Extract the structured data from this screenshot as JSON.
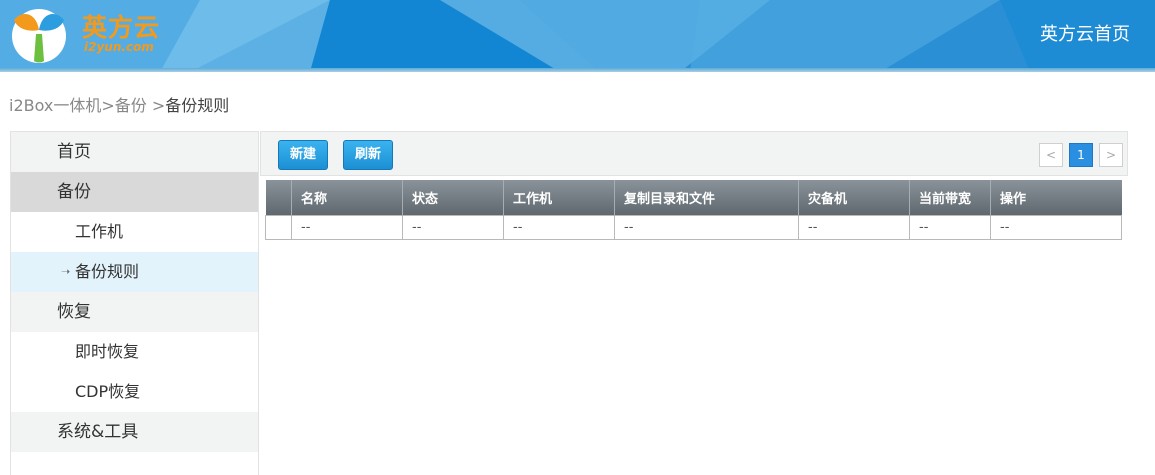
{
  "header": {
    "brand": "英方云",
    "brand_sub": "i2yun.com",
    "home_link": "英方云首页"
  },
  "breadcrumb": {
    "path": "i2Box一体机>备份 >",
    "current": "备份规则"
  },
  "sidebar": {
    "items": [
      {
        "label": "首页",
        "level": "top",
        "active": false
      },
      {
        "label": "备份",
        "level": "top",
        "active": true
      },
      {
        "label": "工作机",
        "level": "sub",
        "active": false
      },
      {
        "label": "备份规则",
        "level": "sub",
        "active": true
      },
      {
        "label": "恢复",
        "level": "top",
        "active": false
      },
      {
        "label": "即时恢复",
        "level": "sub",
        "active": false
      },
      {
        "label": "CDP恢复",
        "level": "sub",
        "active": false
      },
      {
        "label": "系统&工具",
        "level": "top",
        "active": false
      }
    ]
  },
  "toolbar": {
    "new_label": "新建",
    "refresh_label": "刷新",
    "pager_prev": "<",
    "pager_current": "1",
    "pager_next": ">"
  },
  "table": {
    "columns": [
      "",
      "名称",
      "状态",
      "工作机",
      "复制目录和文件",
      "灾备机",
      "当前带宽",
      "操作"
    ],
    "rows": [
      [
        "",
        "--",
        "--",
        "--",
        "--",
        "--",
        "--",
        "--"
      ]
    ]
  },
  "colors": {
    "header_blue": "#2a8fd4",
    "brand_orange": "#f39a1d",
    "button_blue": "#1c8fd4"
  }
}
